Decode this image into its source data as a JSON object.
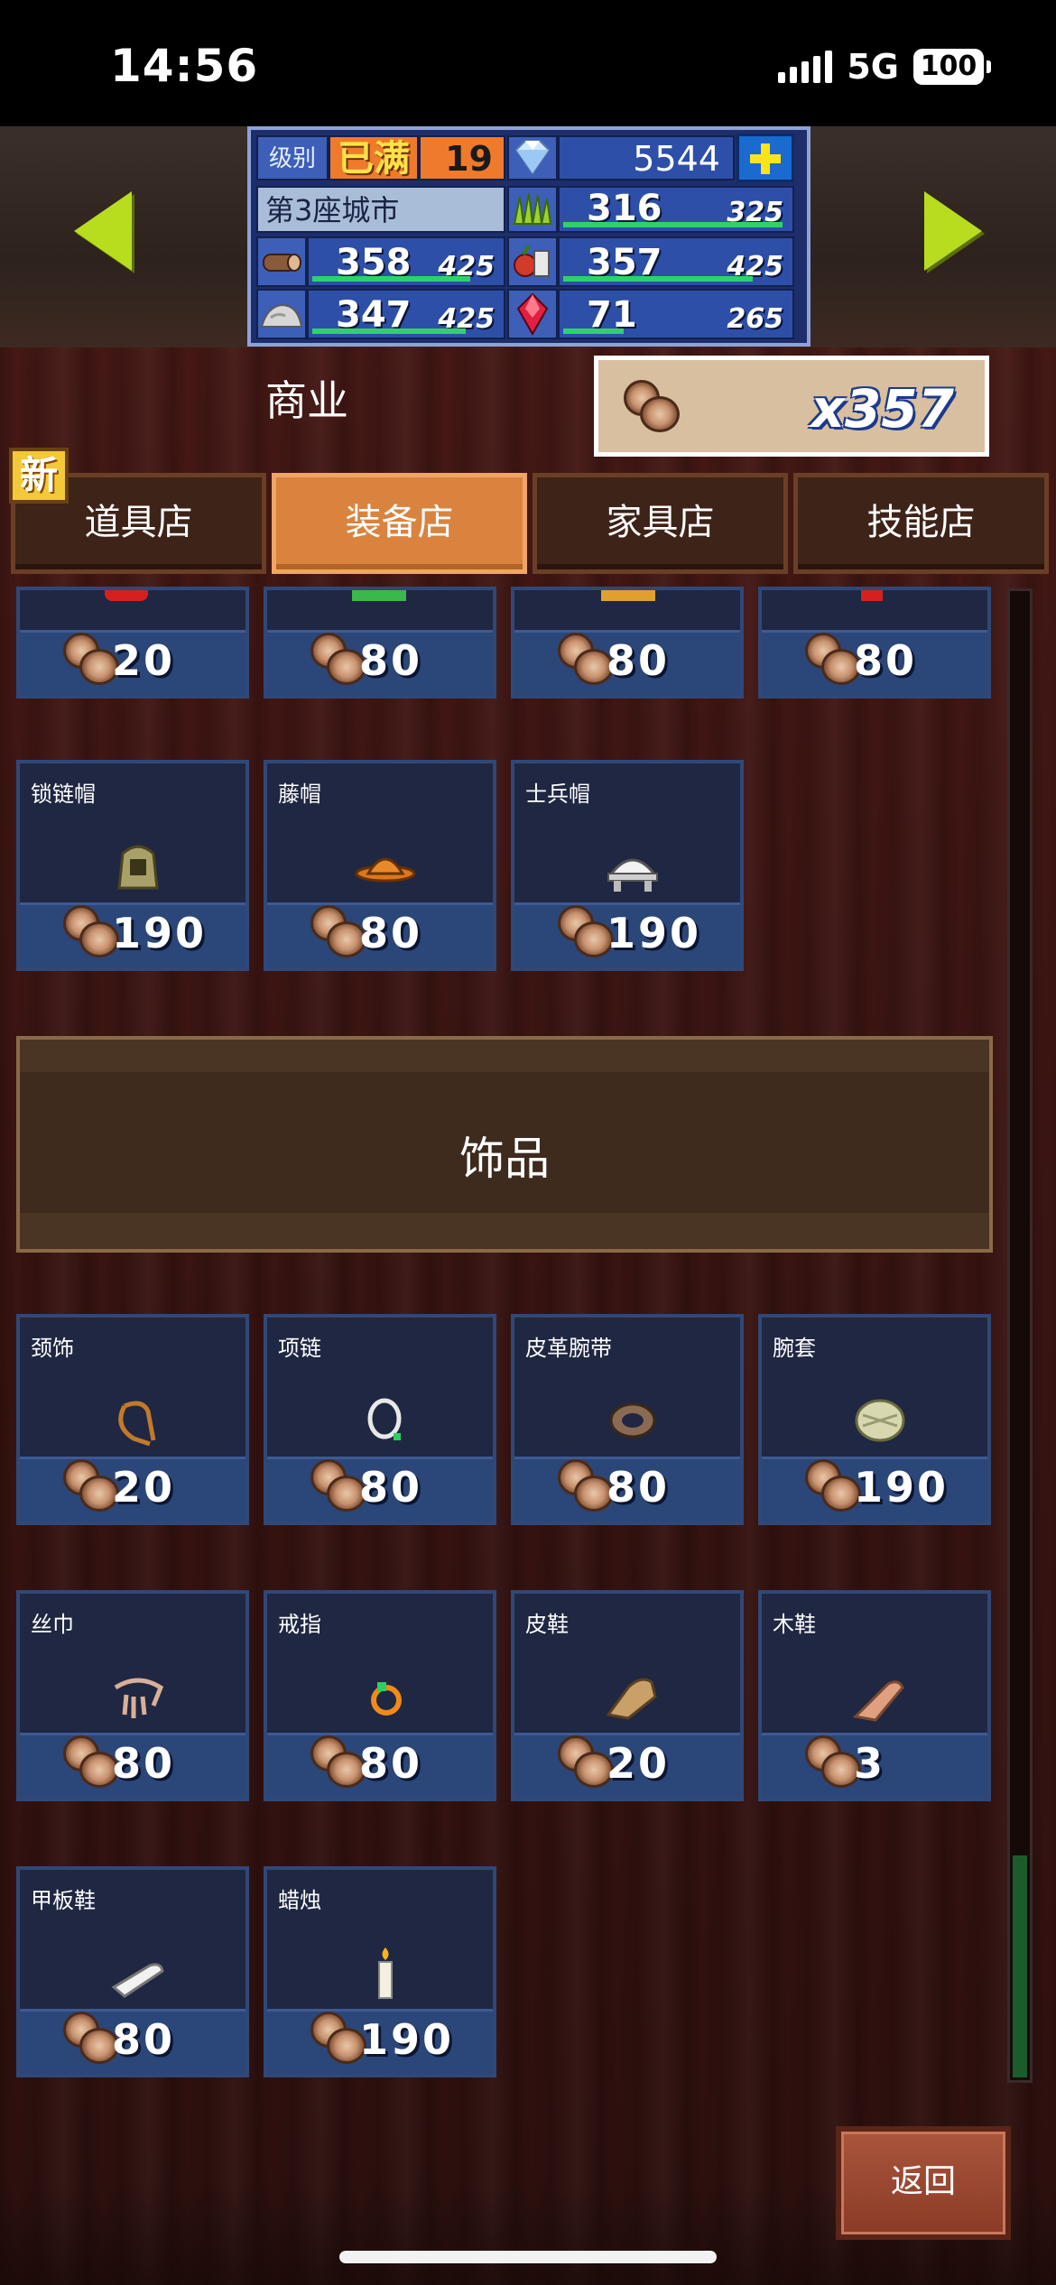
{
  "status": {
    "time": "14:56",
    "network": "5G",
    "battery": "100"
  },
  "header": {
    "level_label": "级别",
    "level_status": "已满",
    "level": "19",
    "gems": "5544",
    "city": "第3座城市",
    "resources": [
      {
        "name": "grass",
        "value": "316",
        "max": "325",
        "fill": 0.972
      },
      {
        "name": "wood",
        "value": "358",
        "max": "425",
        "fill": 0.842
      },
      {
        "name": "food",
        "value": "357",
        "max": "425",
        "fill": 0.84
      },
      {
        "name": "stone",
        "value": "347",
        "max": "425",
        "fill": 0.816
      },
      {
        "name": "ruby",
        "value": "71",
        "max": "265",
        "fill": 0.268
      }
    ]
  },
  "commerce": {
    "label": "商业",
    "wood_count": "x357"
  },
  "new_badge": "新",
  "tabs": [
    {
      "label": "道具店",
      "active": false
    },
    {
      "label": "装备店",
      "active": true
    },
    {
      "label": "家具店",
      "active": false
    },
    {
      "label": "技能店",
      "active": false
    }
  ],
  "top_row_prices": [
    "20",
    "80",
    "80",
    "80"
  ],
  "hats": [
    {
      "name": "锁链帽",
      "price": "190"
    },
    {
      "name": "藤帽",
      "price": "80"
    },
    {
      "name": "士兵帽",
      "price": "190"
    }
  ],
  "section_title": "饰品",
  "accessories": [
    {
      "name": "颈饰",
      "price": "20"
    },
    {
      "name": "项链",
      "price": "80"
    },
    {
      "name": "皮革腕带",
      "price": "80"
    },
    {
      "name": "腕套",
      "price": "190"
    },
    {
      "name": "丝巾",
      "price": "80"
    },
    {
      "name": "戒指",
      "price": "80"
    },
    {
      "name": "皮鞋",
      "price": "20"
    },
    {
      "name": "木鞋",
      "price": "3"
    },
    {
      "name": "甲板鞋",
      "price": "80"
    },
    {
      "name": "蜡烛",
      "price": "190"
    }
  ],
  "back_label": "返回"
}
